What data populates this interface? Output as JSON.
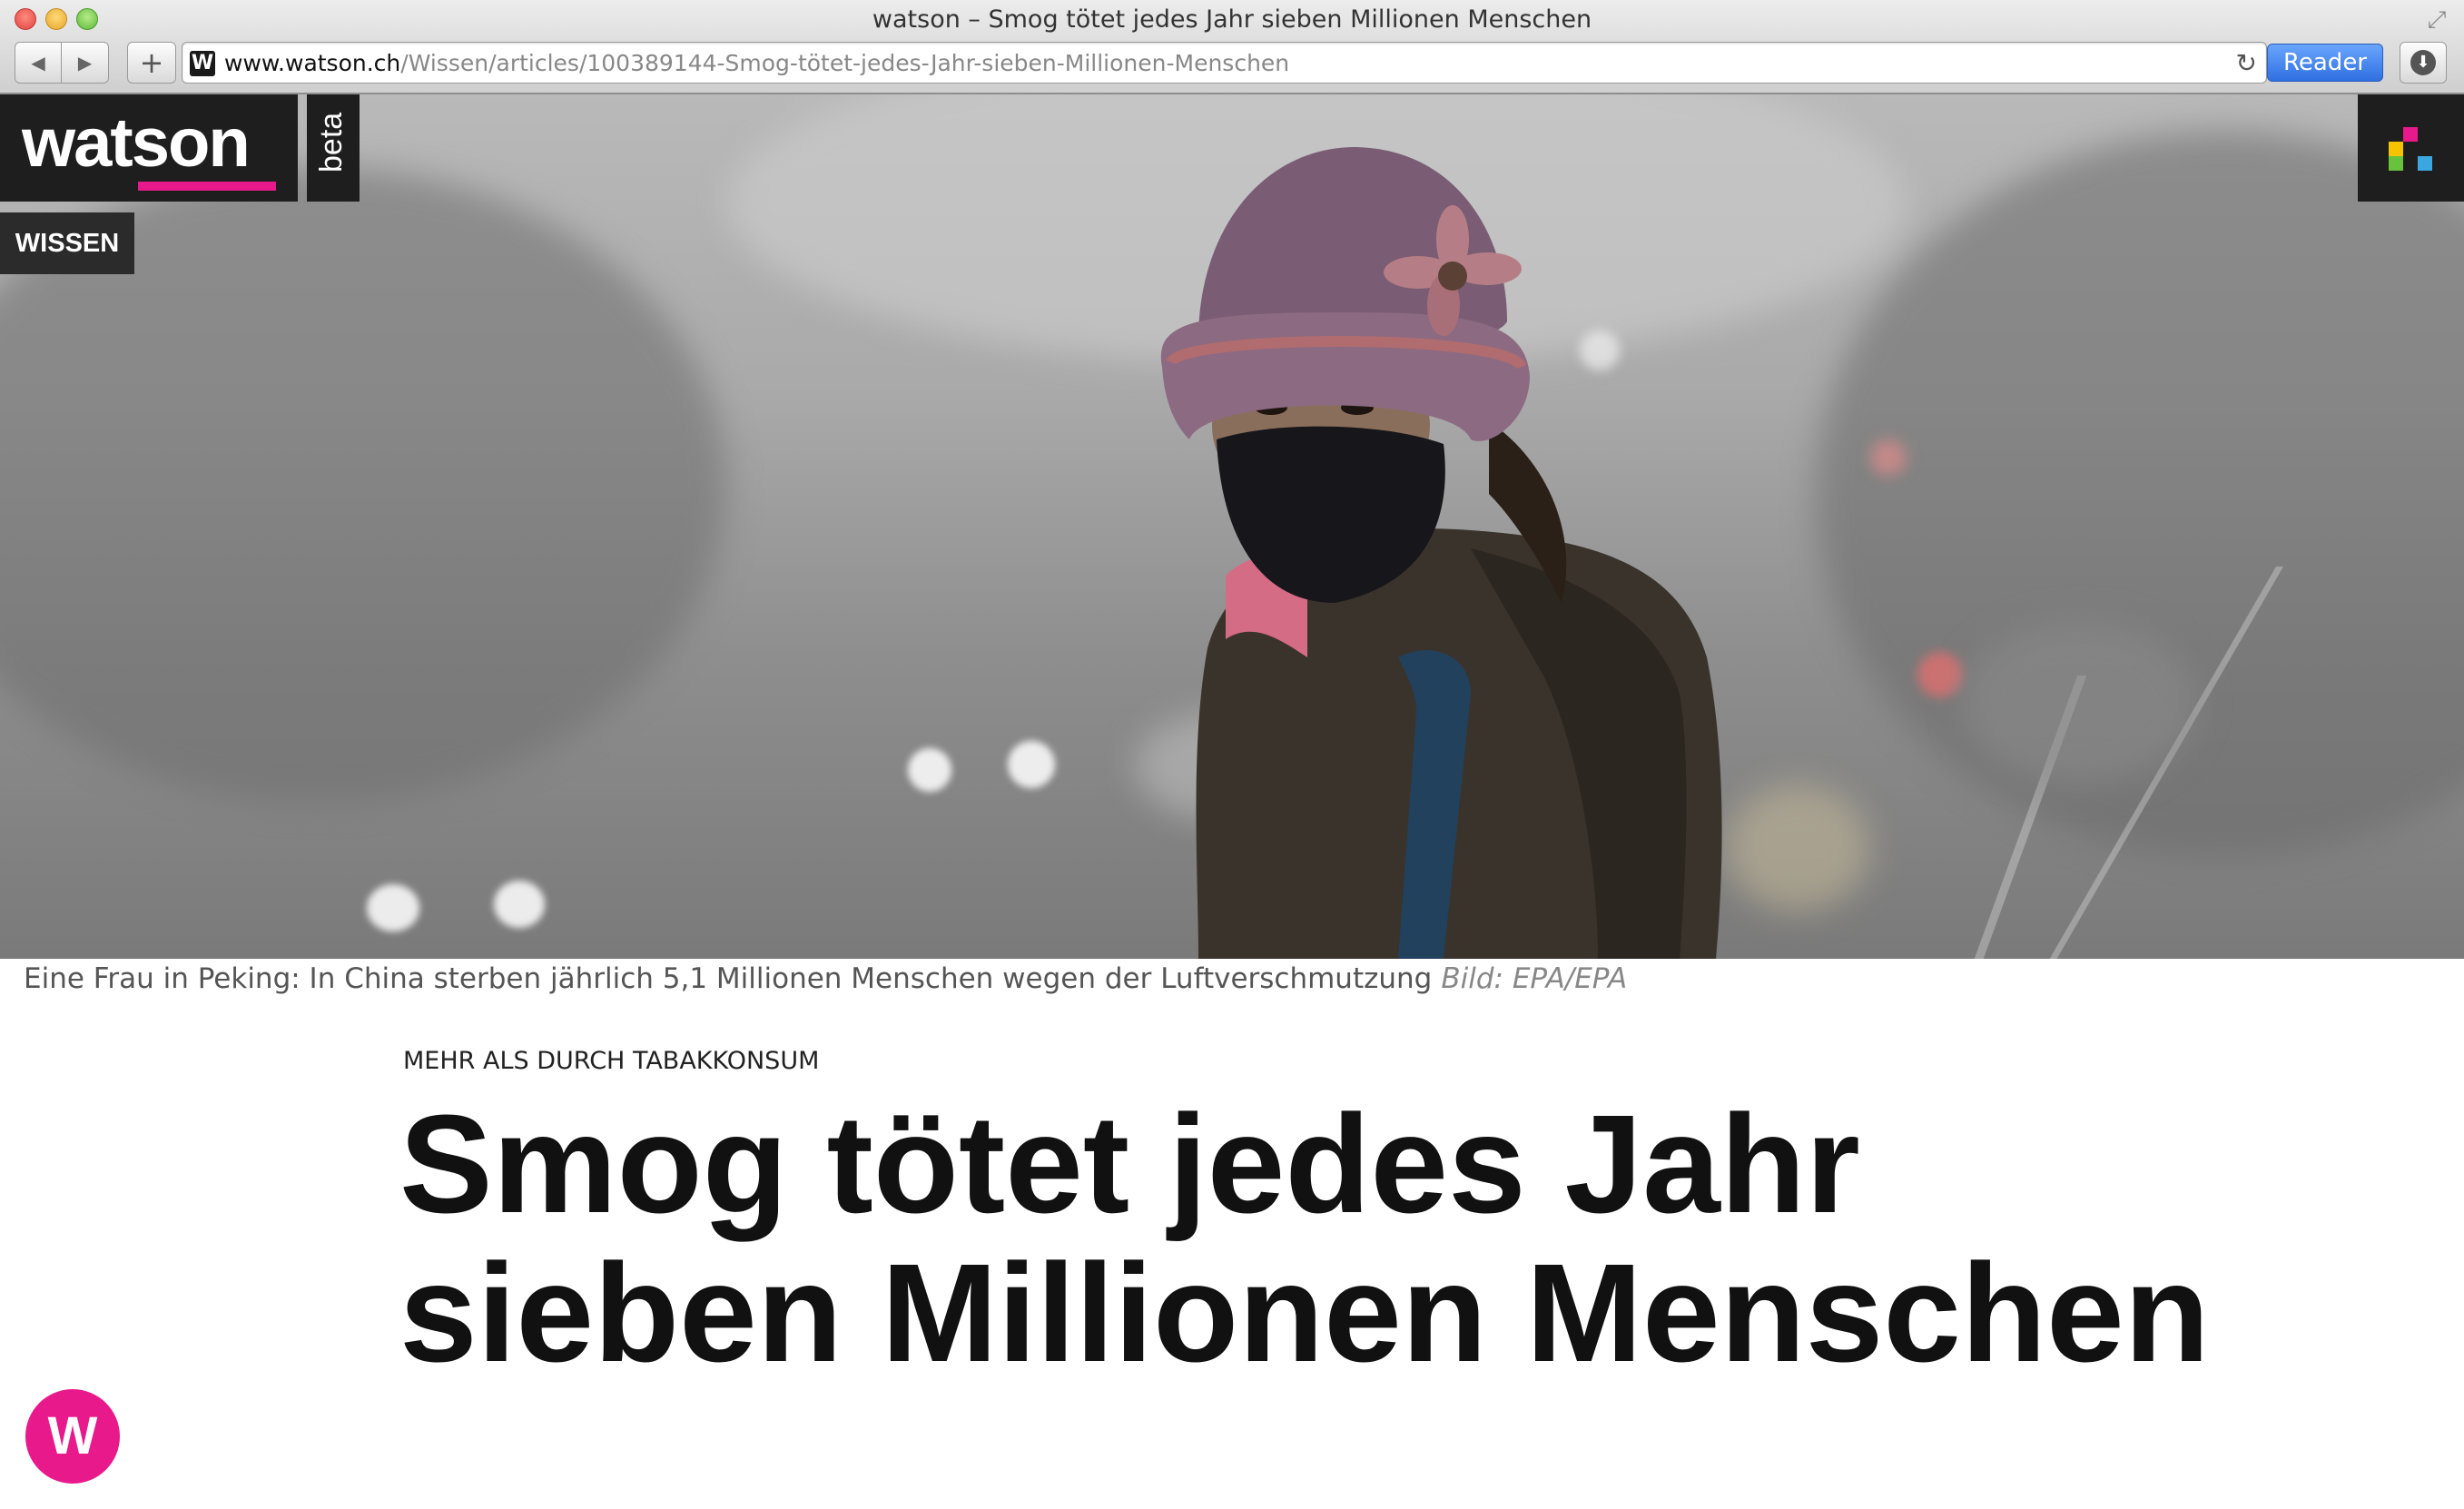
{
  "window": {
    "title": "watson – Smog tötet jedes Jahr sieben Millionen Menschen"
  },
  "toolbar": {
    "back_icon": "◀",
    "forward_icon": "▶",
    "add_icon": "+",
    "url_host": "www.watson.ch",
    "url_path": "/Wissen/articles/100389144-Smog-tötet-jedes-Jahr-sieben-Millionen-Menschen",
    "favicon_letter": "W",
    "reader_label": "Reader",
    "reload_icon": "↻",
    "download_icon": "⬇"
  },
  "site": {
    "logo": "watson",
    "beta_label": "beta",
    "section": "WISSEN",
    "brand_color": "#e8198b",
    "menu_colors": [
      "#e8198b",
      "#3aa7e0",
      "#f5c400",
      "#67c33b"
    ],
    "fab_letter": "W"
  },
  "article": {
    "caption": "Eine Frau in Peking: In China sterben jährlich 5,1 Millionen Menschen wegen der Luftverschmutzung",
    "caption_credit": "Bild: EPA/EPA",
    "overline": "MEHR ALS DURCH TABAKKONSUM",
    "headline": "Smog tötet jedes Jahr sieben Millionen Menschen"
  }
}
